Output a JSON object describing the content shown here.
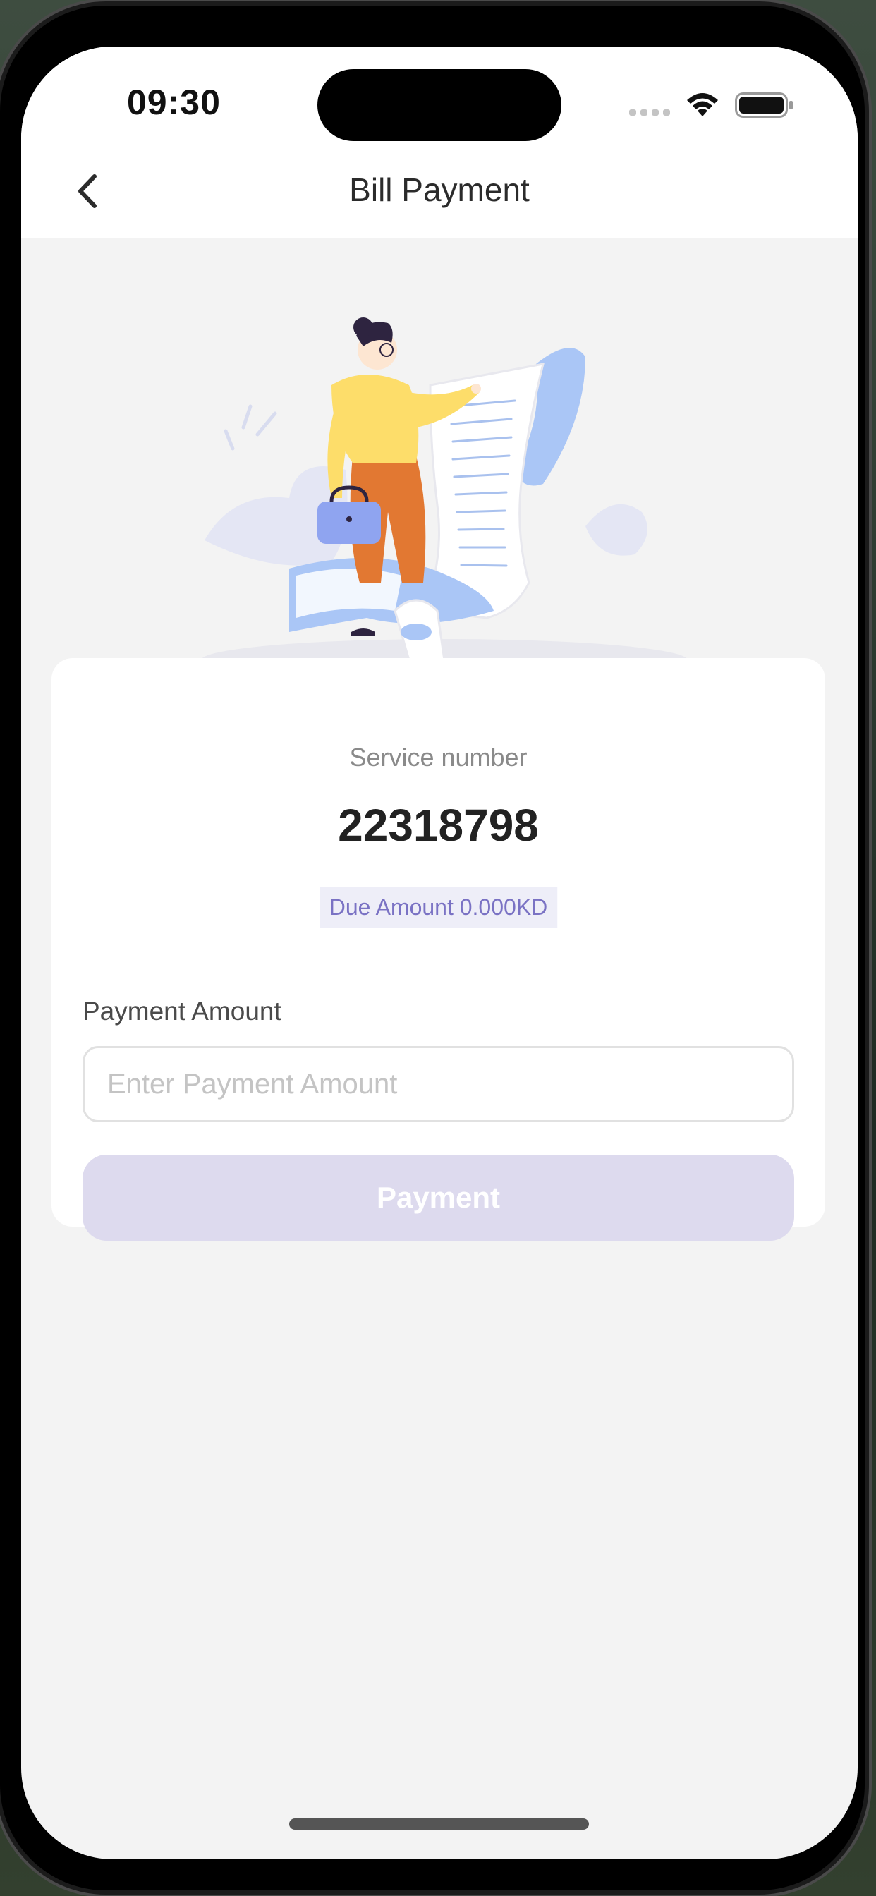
{
  "status_bar": {
    "time": "09:30"
  },
  "nav": {
    "title": "Bill Payment"
  },
  "card": {
    "service_label": "Service number",
    "service_number": "22318798",
    "due_amount": "Due Amount 0.000KD",
    "payment_label": "Payment Amount",
    "payment_placeholder": "Enter Payment Amount",
    "payment_value": "",
    "payment_button": "Payment"
  },
  "icons": {
    "back": "chevron-left-icon",
    "wifi": "wifi-icon",
    "battery": "battery-icon",
    "cellular": "cellular-signal-icon"
  },
  "colors": {
    "accent": "#7a72c4",
    "button_disabled": "#dddaee",
    "due_badge_bg": "#eeeef8"
  }
}
